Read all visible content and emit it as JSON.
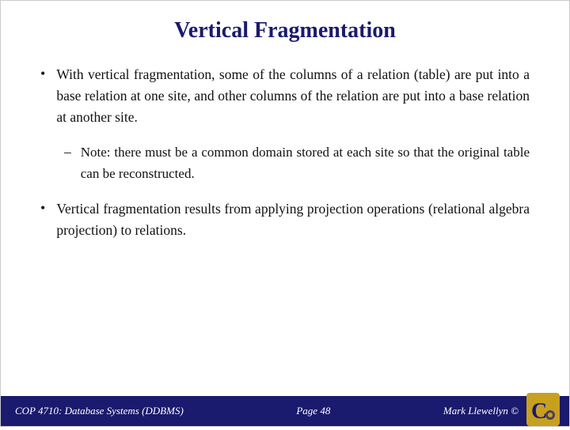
{
  "slide": {
    "title": "Vertical Fragmentation",
    "bullets": [
      {
        "type": "bullet",
        "text": "With vertical fragmentation, some of the columns of a relation (table) are put into a base relation at one site, and other columns of the relation are put into a base relation at another site."
      },
      {
        "type": "sub",
        "text": "Note: there must be a common domain stored at each site so that the original table can be reconstructed."
      },
      {
        "type": "bullet",
        "text": "Vertical fragmentation results from applying projection operations (relational algebra projection) to relations."
      }
    ],
    "footer": {
      "left": "COP 4710: Database Systems  (DDBMS)",
      "center": "Page 48",
      "right": "Mark Llewellyn ©"
    }
  }
}
